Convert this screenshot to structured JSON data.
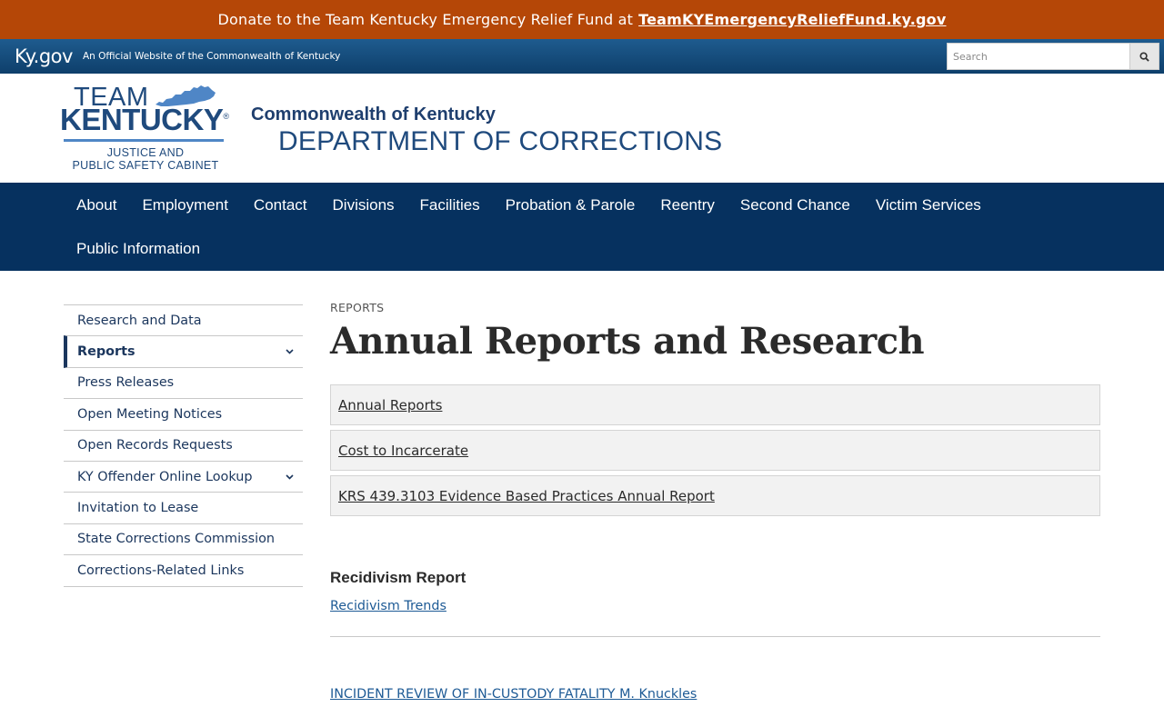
{
  "donate": {
    "text": "Donate to the Team Kentucky Emergency Relief Fund at",
    "link": "TeamKYEmergencyReliefFund.ky.gov"
  },
  "kygov": {
    "logo": "Ky.gov",
    "tagline": "An Official Website of the Commonwealth of Kentucky",
    "search_placeholder": "Search",
    "search_icon": "magnifier-icon"
  },
  "header": {
    "logo_team": "TEAM",
    "logo_kentucky": "KENTUCKY",
    "logo_registered": "®",
    "logo_cabinet_line1": "JUSTICE AND",
    "logo_cabinet_line2": "PUBLIC SAFETY CABINET",
    "commonwealth": "Commonwealth of Kentucky",
    "department": "DEPARTMENT OF CORRECTIONS"
  },
  "nav": {
    "items": [
      "About",
      "Employment",
      "Contact",
      "Divisions",
      "Facilities",
      "Probation & Parole",
      "Reentry",
      "Second Chance",
      "Victim Services",
      "Public Information"
    ]
  },
  "sidenav": {
    "items": [
      {
        "label": "Research and Data"
      },
      {
        "label": "Reports",
        "active": true,
        "expandable": true
      },
      {
        "label": "Press Releases"
      },
      {
        "label": "Open Meeting Notices"
      },
      {
        "label": "Open Records Requests"
      },
      {
        "label": "KY Offender Online Lookup",
        "expandable": true
      },
      {
        "label": "Invitation to Lease"
      },
      {
        "label": "State Corrections Commission"
      },
      {
        "label": "Corrections-Related Links"
      }
    ]
  },
  "main": {
    "kicker": "REPORTS",
    "title": "Annual Reports and Research",
    "report_links": [
      "Annual Reports",
      "Cost to Incarcerate",
      "KRS 439.3103 Evidence Based Practices Annual Report"
    ],
    "recidivism_heading": "Recidivism Report",
    "recidivism_link": "Recidivism Trends",
    "incident_link": "INCIDENT REVIEW OF IN-CUSTODY FATALITY M. Knuckles"
  },
  "colors": {
    "donate_bg": "#b54707",
    "nav_bg": "#06315f",
    "brand_blue": "#1f4a7d",
    "link_blue": "#1d5a95"
  }
}
